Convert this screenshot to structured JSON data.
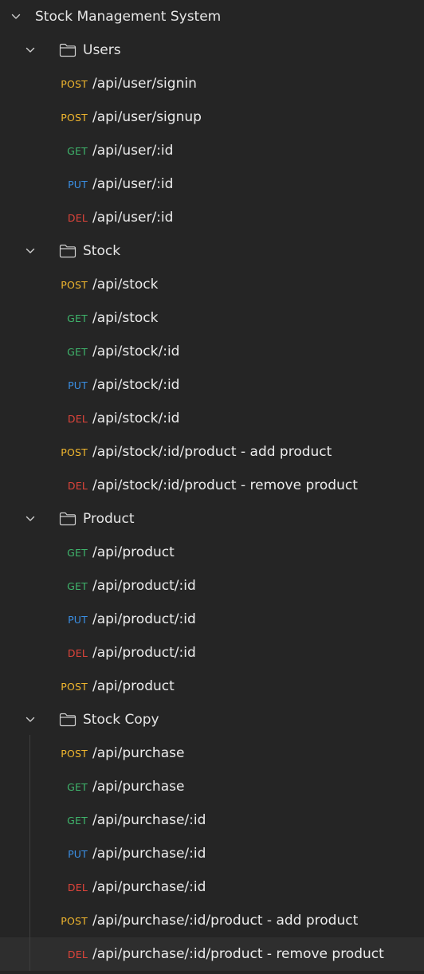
{
  "collection": {
    "title": "Stock Management System",
    "expanded": true
  },
  "folders": [
    {
      "name": "Users",
      "expanded": true,
      "requests": [
        {
          "method": "POST",
          "path": "/api/user/signin"
        },
        {
          "method": "POST",
          "path": "/api/user/signup"
        },
        {
          "method": "GET",
          "path": "/api/user/:id"
        },
        {
          "method": "PUT",
          "path": "/api/user/:id"
        },
        {
          "method": "DEL",
          "path": "/api/user/:id"
        }
      ]
    },
    {
      "name": "Stock",
      "expanded": true,
      "requests": [
        {
          "method": "POST",
          "path": "/api/stock"
        },
        {
          "method": "GET",
          "path": "/api/stock"
        },
        {
          "method": "GET",
          "path": "/api/stock/:id"
        },
        {
          "method": "PUT",
          "path": "/api/stock/:id"
        },
        {
          "method": "DEL",
          "path": "/api/stock/:id"
        },
        {
          "method": "POST",
          "path": "/api/stock/:id/product - add product"
        },
        {
          "method": "DEL",
          "path": "/api/stock/:id/product - remove product"
        }
      ]
    },
    {
      "name": "Product",
      "expanded": true,
      "requests": [
        {
          "method": "GET",
          "path": "/api/product"
        },
        {
          "method": "GET",
          "path": "/api/product/:id"
        },
        {
          "method": "PUT",
          "path": "/api/product/:id"
        },
        {
          "method": "DEL",
          "path": "/api/product/:id"
        },
        {
          "method": "POST",
          "path": "/api/product"
        }
      ]
    },
    {
      "name": "Stock Copy",
      "expanded": true,
      "requests": [
        {
          "method": "POST",
          "path": "/api/purchase"
        },
        {
          "method": "GET",
          "path": "/api/purchase"
        },
        {
          "method": "GET",
          "path": "/api/purchase/:id"
        },
        {
          "method": "PUT",
          "path": "/api/purchase/:id"
        },
        {
          "method": "DEL",
          "path": "/api/purchase/:id"
        },
        {
          "method": "POST",
          "path": "/api/purchase/:id/product - add product"
        },
        {
          "method": "DEL",
          "path": "/api/purchase/:id/product - remove product",
          "selected": true
        }
      ]
    }
  ],
  "colors": {
    "background": "#252525",
    "selected_row": "#2e2e2e",
    "POST": "#f0b62e",
    "GET": "#3fb56c",
    "PUT": "#3a8fe4",
    "DEL": "#e0443b"
  },
  "icons": {
    "collection_toggle": "chevron-down-icon",
    "folder_toggle": "chevron-down-icon",
    "folder": "folder-icon"
  }
}
